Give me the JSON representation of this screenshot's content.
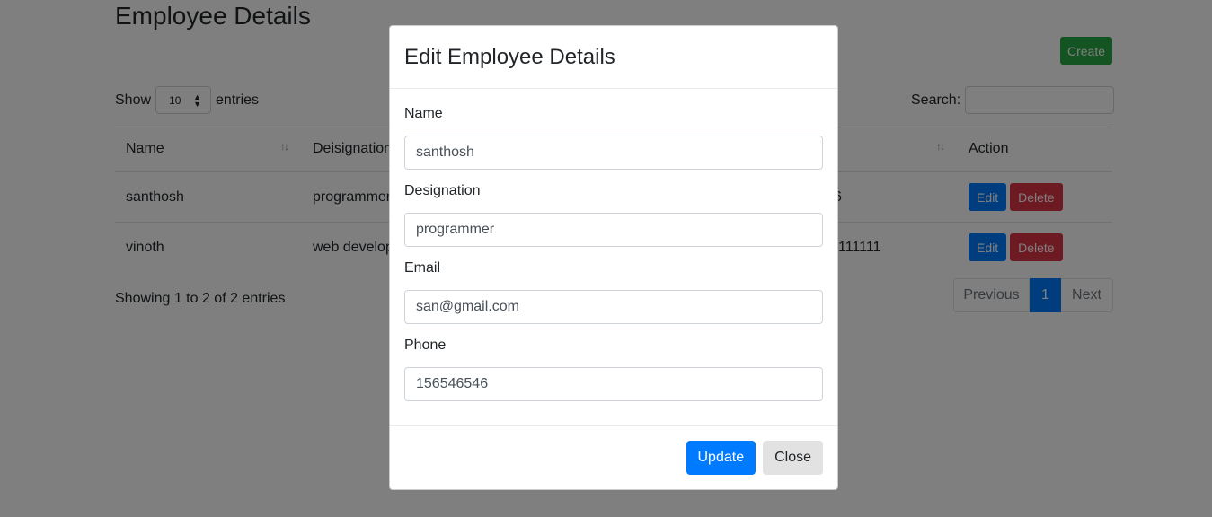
{
  "page": {
    "title": "Employee Details",
    "create_label": "Create"
  },
  "table_controls": {
    "show_label": "Show",
    "entries_value": "10",
    "entries_label": "entries",
    "search_label": "Search:",
    "search_value": ""
  },
  "table": {
    "headers": [
      "Name",
      "Deisignation",
      "",
      "Action"
    ],
    "rows": [
      {
        "name": "santhosh",
        "designation": "programmer",
        "phone_fragment": "6",
        "edit": "Edit",
        "delete": "Delete"
      },
      {
        "name": "vinoth",
        "designation": "web develop",
        "phone_fragment": "111111",
        "edit": "Edit",
        "delete": "Delete"
      }
    ]
  },
  "footer": {
    "info": "Showing 1 to 2 of 2 entries",
    "pagination": {
      "previous": "Previous",
      "current": "1",
      "next": "Next"
    }
  },
  "modal": {
    "title": "Edit Employee Details",
    "fields": [
      {
        "label": "Name",
        "value": "santhosh"
      },
      {
        "label": "Designation",
        "value": "programmer"
      },
      {
        "label": "Email",
        "value": "san@gmail.com"
      },
      {
        "label": "Phone",
        "value": "156546546"
      }
    ],
    "update_label": "Update",
    "close_label": "Close"
  },
  "colors": {
    "primary": "#007bff",
    "success": "#28a745",
    "danger": "#dc3545",
    "backdrop": "rgba(0,0,0,0.5)"
  },
  "icons": [
    "sort-icon",
    "select-arrow-icon"
  ]
}
